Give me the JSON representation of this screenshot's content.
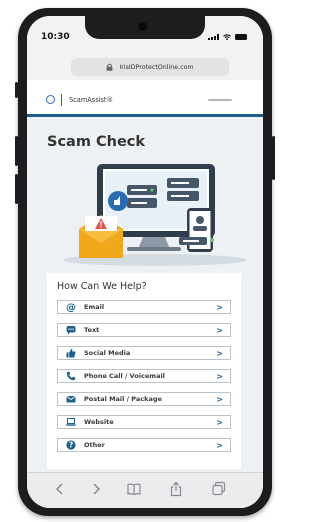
{
  "status_bar": {
    "time": "10:30"
  },
  "browser": {
    "url": "IrisIDProtectOnline.com",
    "toolbar": [
      "back-icon",
      "forward-icon",
      "bookmarks-icon",
      "share-icon",
      "tabs-icon"
    ]
  },
  "site": {
    "brand": "ScamAssist®",
    "page_title": "Scam Check",
    "help_title": "How Can We Help?",
    "options": [
      {
        "label": "Email",
        "icon": "at-icon"
      },
      {
        "label": "Text",
        "icon": "chat-icon"
      },
      {
        "label": "Social Media",
        "icon": "thumbs-up-icon"
      },
      {
        "label": "Phone Call / Voicemail",
        "icon": "phone-icon"
      },
      {
        "label": "Postal Mail / Package",
        "icon": "envelope-icon"
      },
      {
        "label": "Website",
        "icon": "laptop-icon"
      },
      {
        "label": "Other",
        "icon": "question-icon"
      }
    ],
    "chevron": ">"
  },
  "colors": {
    "accent": "#1f5f8b",
    "header_rule": "#1f5f8b",
    "content_bg": "#eef1f4"
  }
}
